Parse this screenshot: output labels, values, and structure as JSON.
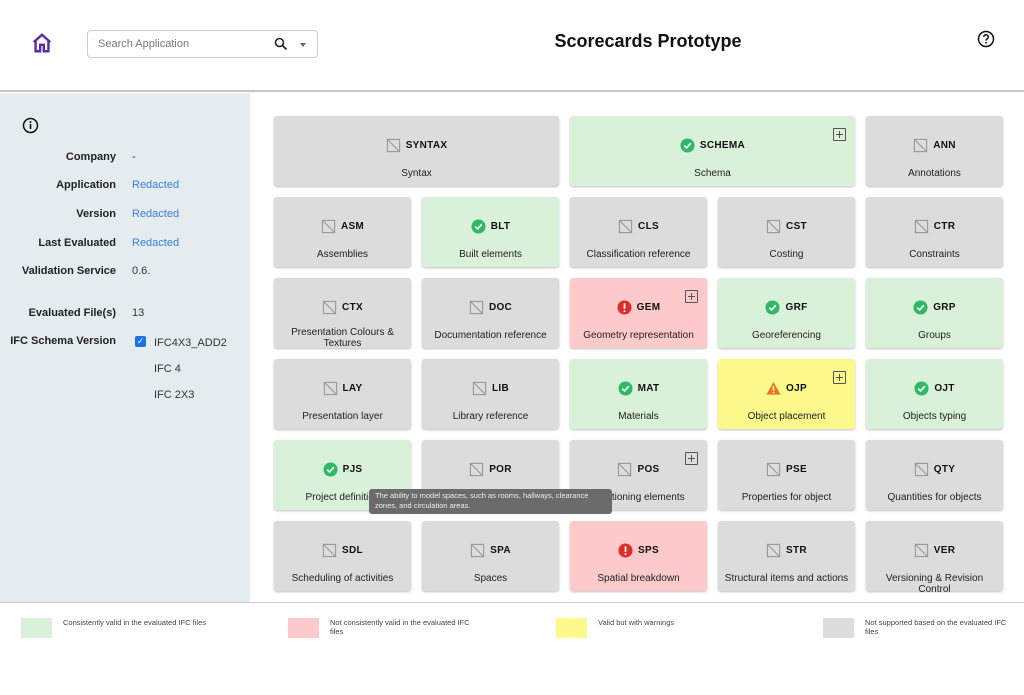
{
  "header": {
    "title": "Scorecards Prototype",
    "search_placeholder": "Search Application",
    "home_icon": "home-icon",
    "help_icon": "help-circle-icon",
    "accent": "#5b2a9e"
  },
  "sidebar": {
    "info_icon": "info-circle-icon",
    "fields": [
      {
        "label": "Company",
        "value": "-",
        "link": false
      },
      {
        "label": "Application",
        "value": "Redacted",
        "link": true
      },
      {
        "label": "Version",
        "value": "Redacted",
        "link": true
      },
      {
        "label": "Last Evaluated",
        "value": "Redacted",
        "link": true
      },
      {
        "label": "Validation Service",
        "value": "0.6.",
        "link": false
      },
      {
        "label": "Evaluated File(s)",
        "value": "13",
        "link": false
      }
    ],
    "schema_label": "IFC Schema Version",
    "schemas": [
      {
        "name": "IFC4X3_ADD2",
        "checked": true
      },
      {
        "name": "IFC 4",
        "checked": false
      },
      {
        "name": "IFC 2X3",
        "checked": false
      }
    ]
  },
  "colors": {
    "green": "#d9f0d9",
    "red": "#fccaca",
    "yellow": "#fbf98a",
    "gray": "#dcdcdc",
    "ok_icon": "#2fb866",
    "error_icon": "#d9302c",
    "warn_icon": "#e9761b"
  },
  "tiles": [
    {
      "code": "SYNTAX",
      "label": "Syntax",
      "status": "gray",
      "span": 2
    },
    {
      "code": "SCHEMA",
      "label": "Schema",
      "status": "green",
      "span": 2,
      "expand": true
    },
    {
      "code": "ANN",
      "label": "Annotations",
      "status": "gray"
    },
    {
      "code": "ASM",
      "label": "Assemblies",
      "status": "gray"
    },
    {
      "code": "BLT",
      "label": "Built elements",
      "status": "green"
    },
    {
      "code": "CLS",
      "label": "Classification reference",
      "status": "gray"
    },
    {
      "code": "CST",
      "label": "Costing",
      "status": "gray"
    },
    {
      "code": "CTR",
      "label": "Constraints",
      "status": "gray"
    },
    {
      "code": "CTX",
      "label": "Presentation Colours & Textures",
      "status": "gray"
    },
    {
      "code": "DOC",
      "label": "Documentation reference",
      "status": "gray"
    },
    {
      "code": "GEM",
      "label": "Geometry representation",
      "status": "red",
      "expand": true
    },
    {
      "code": "GRF",
      "label": "Georeferencing",
      "status": "green"
    },
    {
      "code": "GRP",
      "label": "Groups",
      "status": "green"
    },
    {
      "code": "LAY",
      "label": "Presentation layer",
      "status": "gray"
    },
    {
      "code": "LIB",
      "label": "Library reference",
      "status": "gray"
    },
    {
      "code": "MAT",
      "label": "Materials",
      "status": "green"
    },
    {
      "code": "OJP",
      "label": "Object placement",
      "status": "yellow",
      "expand": true
    },
    {
      "code": "OJT",
      "label": "Objects typing",
      "status": "green"
    },
    {
      "code": "PJS",
      "label": "Project definition",
      "status": "green"
    },
    {
      "code": "POR",
      "label": "",
      "status": "gray"
    },
    {
      "code": "POS",
      "label": "Positioning elements",
      "status": "gray",
      "expand": true
    },
    {
      "code": "PSE",
      "label": "Properties for object",
      "status": "gray"
    },
    {
      "code": "QTY",
      "label": "Quantities for objects",
      "status": "gray"
    },
    {
      "code": "SDL",
      "label": "Scheduling of activities",
      "status": "gray"
    },
    {
      "code": "SPA",
      "label": "Spaces",
      "status": "gray"
    },
    {
      "code": "SPS",
      "label": "Spatial breakdown",
      "status": "red"
    },
    {
      "code": "STR",
      "label": "Structural items and actions",
      "status": "gray"
    },
    {
      "code": "VER",
      "label": "Versioning & Revision Control",
      "status": "gray"
    }
  ],
  "tooltip": "The ability to model spaces, such as rooms, hallways, clearance zones, and circulation areas.",
  "legend": [
    {
      "color": "#d9f0d9",
      "text": "Consistently valid in the evaluated IFC files"
    },
    {
      "color": "#fccaca",
      "text": "Not consistently valid in the evaluated IFC files"
    },
    {
      "color": "#fbf98a",
      "text": "Valid but with warnings"
    },
    {
      "color": "#dcdcdc",
      "text": "Not supported based on the evaluated IFC files"
    }
  ]
}
